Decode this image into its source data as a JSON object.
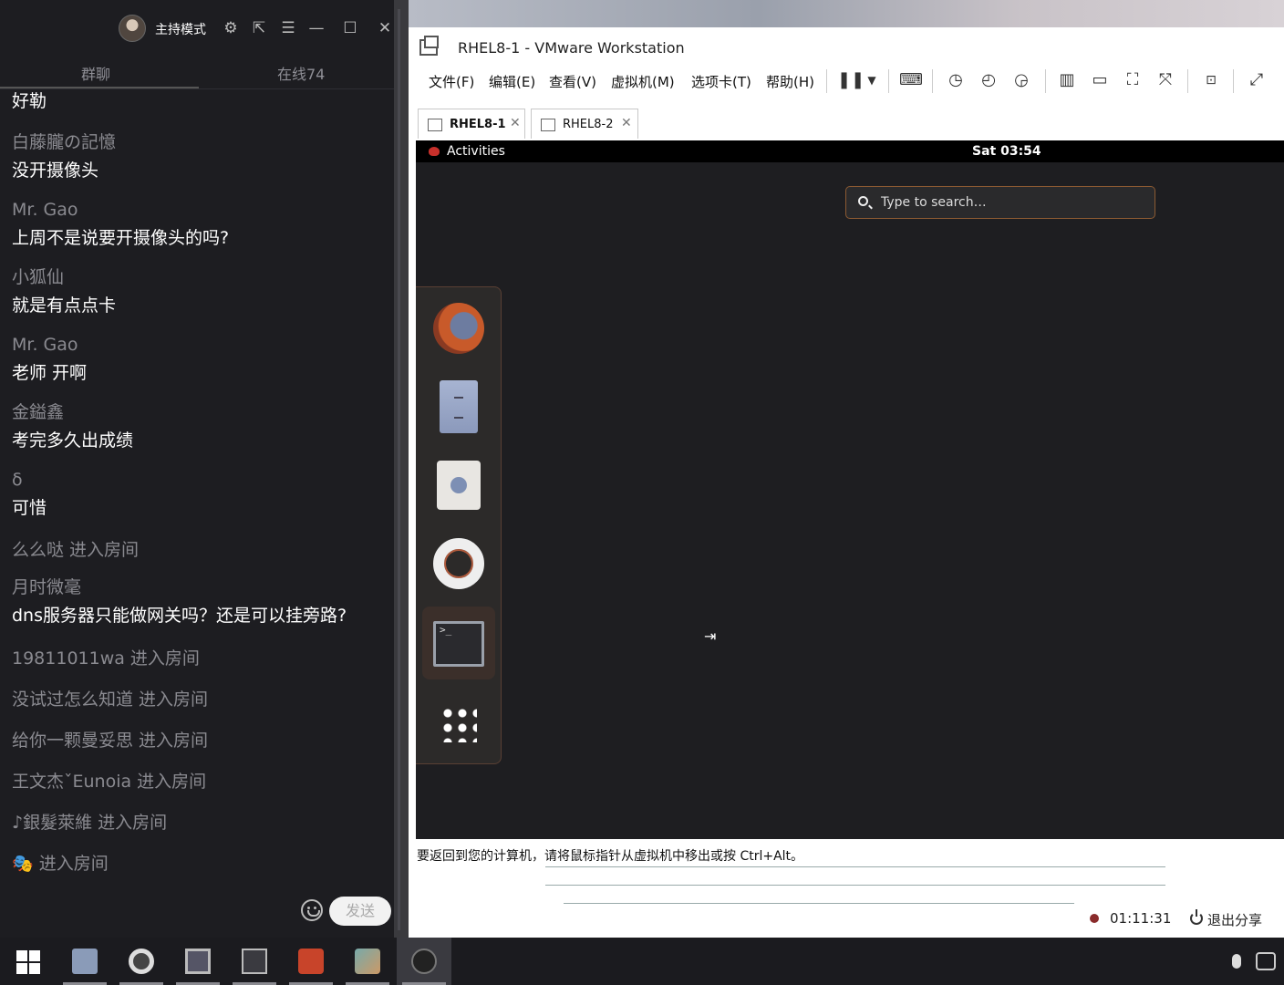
{
  "chat": {
    "host_mode": "主持模式",
    "tabs": [
      "群聊",
      "在线74"
    ],
    "messages": [
      {
        "name": "",
        "text": "好勒"
      },
      {
        "name": "白藤朧の記憶",
        "text": "没开摄像头"
      },
      {
        "name": "Mr. Gao",
        "text": "上周不是说要开摄像头的吗?"
      },
      {
        "name": "小狐仙",
        "text": "就是有点点卡"
      },
      {
        "name": "Mr. Gao",
        "text": "老师 开啊"
      },
      {
        "name": "金鎰鑫",
        "text": "考完多久出成绩"
      },
      {
        "name": "δ",
        "text": "可惜"
      }
    ],
    "join1": "么么哒 进入房间",
    "msg_dns": {
      "name": "月时微毫",
      "text": "dns服务器只能做网关吗？还是可以挂旁路?"
    },
    "joins": [
      "19811011wa 进入房间",
      "没试过怎么知道 进入房间",
      "给你一颗曼妥思 进入房间",
      "王文杰ˇEunoia 进入房间",
      "♪銀髮萊維 进入房间",
      "🎭 进入房间"
    ],
    "send_label": "发送"
  },
  "vmware": {
    "title": "RHEL8-1 - VMware Workstation",
    "menu": [
      "文件(F)",
      "编辑(E)",
      "查看(V)",
      "虚拟机(M)",
      "选项卡(T)",
      "帮助(H)"
    ],
    "tabs": [
      "RHEL8-1",
      "RHEL8-2"
    ],
    "hint": "要返回到您的计算机，请将鼠标指针从虚拟机中移出或按 Ctrl+Alt。",
    "record_time": "01:11:31",
    "stop_share": "退出分享"
  },
  "guest": {
    "activities": "Activities",
    "clock": "Sat 03:54",
    "search_placeholder": "Type to search…",
    "dash_apps": [
      "firefox-icon",
      "files-icon",
      "software-icon",
      "help-icon",
      "terminal-icon",
      "show-apps-icon"
    ]
  },
  "colors": {
    "chat_bg": "#1d1d21",
    "guest_bg": "#1e1e21",
    "search_border": "#8c5a32",
    "taskbar_bg": "#1b1b1f"
  }
}
